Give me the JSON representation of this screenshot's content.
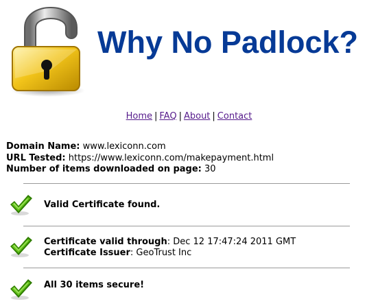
{
  "header": {
    "title": "Why No Padlock?",
    "logo_icon": "open-padlock-icon"
  },
  "nav": {
    "items": [
      "Home",
      "FAQ",
      "About",
      "Contact"
    ],
    "separator": "|"
  },
  "info": {
    "domain_label": "Domain Name:",
    "domain_value": "www.lexiconn.com",
    "url_label": "URL Tested:",
    "url_value": "https://www.lexiconn.com/makepayment.html",
    "items_label": "Number of items downloaded on page:",
    "items_value": "30"
  },
  "results": {
    "certificate_found": "Valid Certificate found.",
    "valid_through_label": "Certificate valid through",
    "valid_through_value": ": Dec 12 17:47:24 2011 GMT",
    "issuer_label": "Certificate Issuer",
    "issuer_value": ": GeoTrust Inc",
    "items_secure": "All 30 items secure!"
  },
  "colors": {
    "title": "#063a96",
    "link": "#551a8b",
    "check_green": "#5cb800",
    "padlock_gold": "#e8b400"
  },
  "icons": [
    "open-padlock-icon",
    "checkmark-icon"
  ]
}
